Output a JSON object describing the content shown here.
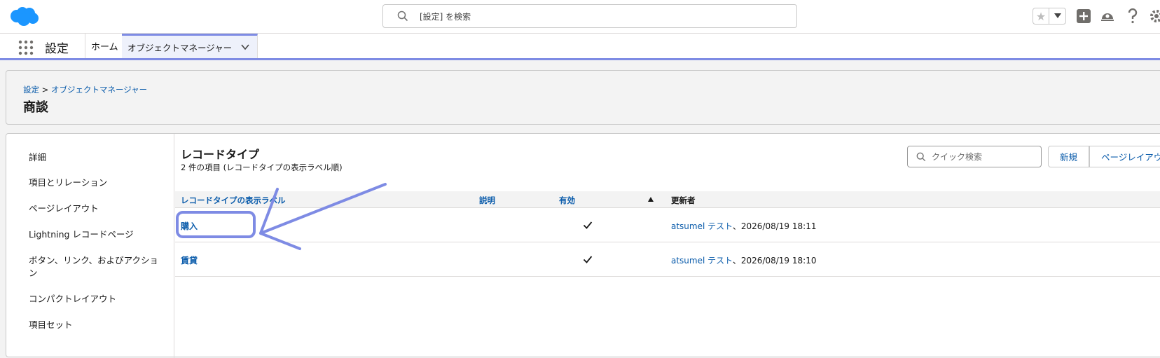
{
  "header": {
    "search_placeholder": "[設定] を検索"
  },
  "nav": {
    "app_name": "設定",
    "home_tab": "ホーム",
    "active_tab": "オブジェクトマネージャー"
  },
  "page": {
    "breadcrumb_root": "設定",
    "breadcrumb_sep": ">",
    "breadcrumb_current": "オブジェクトマネージャー",
    "title": "商談"
  },
  "sidebar": {
    "items": [
      {
        "label": "詳細"
      },
      {
        "label": "項目とリレーション"
      },
      {
        "label": "ページレイアウト"
      },
      {
        "label": "Lightning レコードページ"
      },
      {
        "label": "ボタン、リンク、およびアクション"
      },
      {
        "label": "コンパクトレイアウト"
      },
      {
        "label": "項目セット"
      }
    ]
  },
  "record_types": {
    "title": "レコードタイプ",
    "subtitle": "2 件の項目 (レコードタイプの表示ラベル順)",
    "quick_search_placeholder": "クイック検索",
    "buttons": {
      "new": "新規",
      "page_layout": "ページレイアウト"
    },
    "columns": {
      "label": "レコードタイプの表示ラベル",
      "description": "説明",
      "active": "有効",
      "modified_by": "更新者"
    },
    "rows": [
      {
        "label": "購入",
        "description": "",
        "active": true,
        "user": "atsumel テスト",
        "date": "、2026/08/19 18:11"
      },
      {
        "label": "賃貸",
        "description": "",
        "active": true,
        "user": "atsumel テスト",
        "date": "、2026/08/19 18:10"
      }
    ]
  },
  "colors": {
    "brand": "#0b5cab",
    "salesforce_blue": "#1b96ff",
    "accent": "#7e8be4",
    "annotation": "#7e8be4"
  }
}
